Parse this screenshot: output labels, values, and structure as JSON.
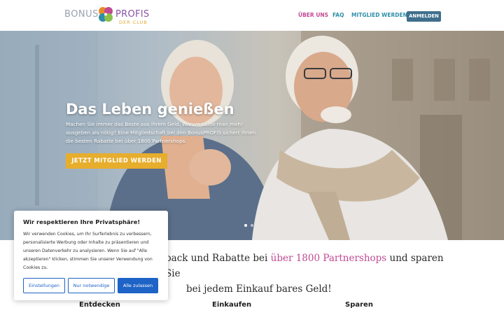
{
  "header": {
    "logo": {
      "left": "BONUS",
      "right": "PROFIS",
      "sub": "DER CLUB"
    },
    "nav": [
      {
        "label": "ÜBER UNS"
      },
      {
        "label": "FAQ"
      },
      {
        "label": "MITGLIED WERDEN"
      }
    ],
    "login_label": "ANMELDEN"
  },
  "hero": {
    "title": "Das Leben genießen",
    "text": "Machen Sie immer das Beste aus Ihrem Geld. Warum sollte man mehr ausgeben als nötig? Eine Mitgliedschaft bei den BonusPROFIS sichert Ihnen die besten Rabatte bei über 1800 Partnershops.",
    "cta_label": "JETZT MITGLIED WERDEN"
  },
  "intro": {
    "part1": "back und Rabatte bei ",
    "highlight": "über 1800 Partnershops",
    "part2": " und sparen Sie",
    "line2": "bei jedem Einkauf bares Geld!"
  },
  "columns": [
    {
      "title": "Entdecken"
    },
    {
      "title": "Einkaufen"
    },
    {
      "title": "Sparen"
    }
  ],
  "cookie": {
    "title": "Wir respektieren Ihre Privatsphäre!",
    "text": "Wir verwenden Cookies, um Ihr Surferlebnis zu verbessern, personalisierte Werbung oder Inhalte zu präsentieren und unseren Datenverkehr zu analysieren. Wenn Sie auf \"Alle akzeptieren\" klicken, stimmen Sie unserer Verwendung von Cookies zu.",
    "settings_label": "Einstellungen",
    "necessary_label": "Nur notwendige",
    "accept_label": "Alle zulassen"
  },
  "colors": {
    "nav": "#2f8fa8",
    "nav_active": "#c04a93",
    "cta": "#e7ad2c",
    "login": "#3f6f8c",
    "cookie_button": "#1e63c6",
    "highlight": "#c04a93"
  },
  "icons": {
    "logo": "clover-icon"
  },
  "slider": {
    "slides": 2,
    "active": 1
  }
}
